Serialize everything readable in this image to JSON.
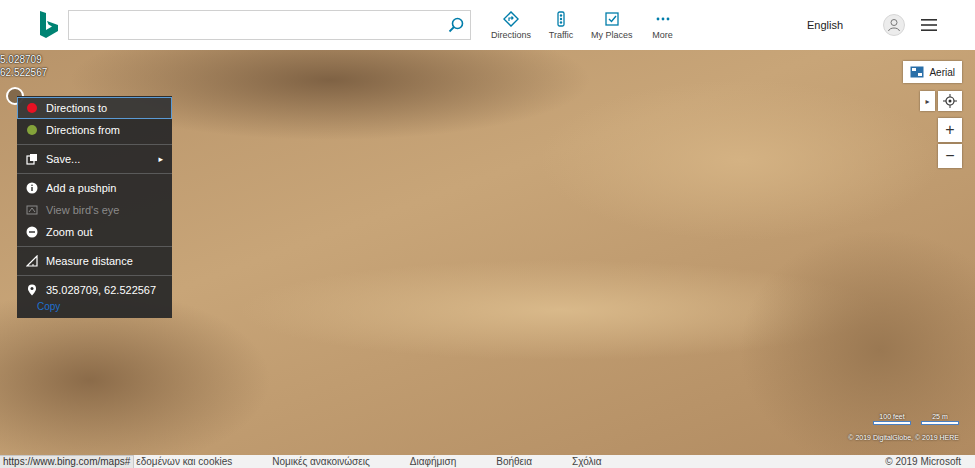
{
  "header": {
    "search": {
      "placeholder": "",
      "value": ""
    },
    "nav": [
      {
        "label": "Directions",
        "kind": "directions"
      },
      {
        "label": "Traffic",
        "kind": "traffic"
      },
      {
        "label": "My Places",
        "kind": "places"
      },
      {
        "label": "More",
        "kind": "more"
      }
    ],
    "language": "English"
  },
  "map": {
    "coordinates": [
      "5.028709",
      "62.522567"
    ],
    "type_button": "Aerial",
    "expander": "▸",
    "zoom_in": "+",
    "zoom_out": "−",
    "scale": [
      "100 feet",
      "25 m"
    ],
    "attribution": "© 2019 DigitalGlobe, © 2019 HERE"
  },
  "context_menu": {
    "groups": [
      [
        {
          "label": "Directions to",
          "kind": "dot",
          "color": "#e81123",
          "selected": true,
          "disabled": false
        },
        {
          "label": "Directions from",
          "kind": "dot",
          "color": "#84a33a",
          "selected": false,
          "disabled": false
        }
      ],
      [
        {
          "label": "Save...",
          "kind": "submenu",
          "arrow": "▸",
          "selected": false,
          "disabled": false
        }
      ],
      [
        {
          "label": "Add a pushpin",
          "kind": "info",
          "selected": false,
          "disabled": false
        },
        {
          "label": "View bird's eye",
          "kind": "birdseye",
          "selected": false,
          "disabled": true
        },
        {
          "label": "Zoom out",
          "kind": "minus",
          "selected": false,
          "disabled": false
        }
      ],
      [
        {
          "label": "Measure distance",
          "kind": "ruler",
          "selected": false,
          "disabled": false
        }
      ],
      [
        {
          "label": "35.028709, 62.522567",
          "kind": "coords",
          "copy": "Copy",
          "selected": false,
          "disabled": false
        }
      ]
    ]
  },
  "footer": {
    "status_url": "https://www.bing.com/maps#",
    "links": [
      "εδομένων και cookies",
      "Νομικές ανακοινώσεις",
      "Διαφήμιση",
      "Βοήθεια",
      "Σχόλια"
    ],
    "copyright": "© 2019 Microsoft"
  }
}
